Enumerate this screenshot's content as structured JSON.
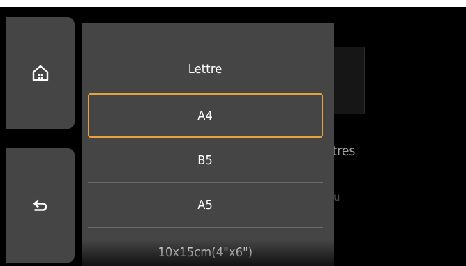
{
  "side_buttons": {
    "home_icon": "home-icon",
    "back_icon": "back-arrow-icon"
  },
  "background_screen": {
    "partial_label": "ètres",
    "partial_label_2": "u"
  },
  "paper_size_list": {
    "items": [
      {
        "label": "Lettre",
        "selected": false
      },
      {
        "label": "A4",
        "selected": true
      },
      {
        "label": "B5",
        "selected": false
      },
      {
        "label": "A5",
        "selected": false
      },
      {
        "label": "10x15cm(4\"x6\")",
        "selected": false
      }
    ]
  },
  "colors": {
    "screen_bg": "#000000",
    "panel_bg": "#454545",
    "selection_border": "#e6a33c",
    "text": "#ffffff"
  }
}
